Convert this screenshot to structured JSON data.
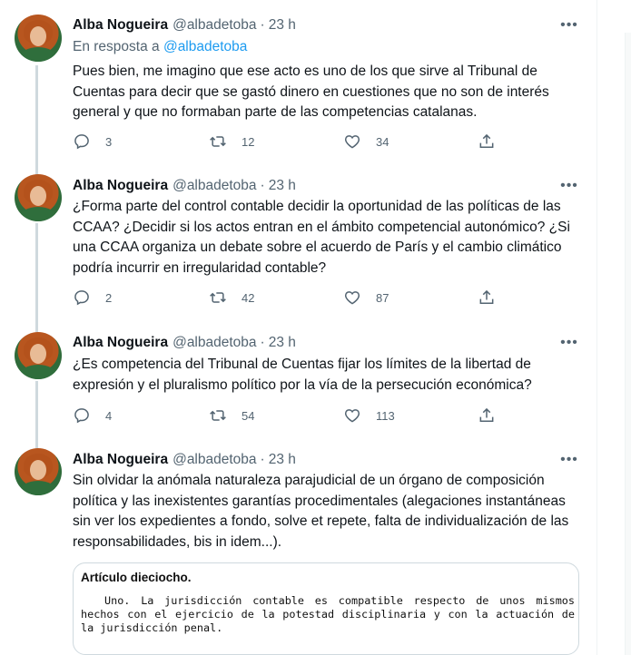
{
  "colors": {
    "accent": "#1d9bf0",
    "secondary_text": "#536471",
    "thread_line": "#cfd9de"
  },
  "tweets": [
    {
      "author": "Alba Nogueira",
      "handle": "@albadetoba",
      "separator": "·",
      "time": "23 h",
      "more_icon": "more-icon",
      "reply_prefix": "En resposta a ",
      "reply_handle": "@albadetoba",
      "text": "Pues bien, me imagino que ese acto es uno de los que sirve al Tribunal de Cuentas para decir que se gastó dinero en cuestiones que no son de interés general y que no formaban parte de las competencias catalanas.",
      "replies": "3",
      "retweets": "12",
      "likes": "34"
    },
    {
      "author": "Alba Nogueira",
      "handle": "@albadetoba",
      "separator": "·",
      "time": "23 h",
      "text": "¿Forma parte del control contable decidir la oportunidad de las políticas de las CCAA? ¿Decidir si los actos entran en el ámbito competencial autonómico? ¿Si una CCAA organiza un debate sobre el acuerdo de París y el cambio climático podría incurrir en irregularidad contable?",
      "replies": "2",
      "retweets": "42",
      "likes": "87"
    },
    {
      "author": "Alba Nogueira",
      "handle": "@albadetoba",
      "separator": "·",
      "time": "23 h",
      "text": "¿Es competencia del Tribunal de Cuentas fijar los límites de la libertad de expresión y el pluralismo político por la vía de la persecución económica?",
      "replies": "4",
      "retweets": "54",
      "likes": "113"
    },
    {
      "author": "Alba Nogueira",
      "handle": "@albadetoba",
      "separator": "·",
      "time": "23 h",
      "text": "Sin olvidar la anómala naturaleza parajudicial de un órgano de composición política y las inexistentes garantías procedimentales (alegaciones instantáneas sin ver los expedientes a fondo, solve et repete, falta de individualización de las responsabilidades, bis in idem...).",
      "quote_title": "Artículo dieciocho.",
      "quote_text": "Uno. La jurisdicción contable es compatible respecto de unos mismos hechos con el ejercicio de la potestad disciplinaria y con la actuación de la jurisdicción penal."
    }
  ]
}
